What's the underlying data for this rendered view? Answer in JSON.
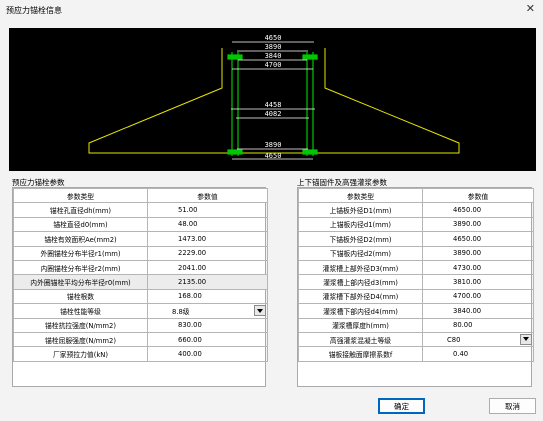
{
  "window": {
    "title": "预应力锚栓信息"
  },
  "drawing": {
    "dims_top": [
      "4650",
      "3890",
      "3840",
      "4700"
    ],
    "dims_mid": [
      "4458",
      "4082"
    ],
    "dims_bot": [
      "3890",
      "4650"
    ]
  },
  "left_panel": {
    "label": "预应力锚栓参数",
    "headers": [
      "参数类型",
      "参数值"
    ],
    "rows": [
      {
        "name": "锚栓孔直径dh(mm)",
        "value": "51.00"
      },
      {
        "name": "锚栓直径d0(mm)",
        "value": "48.00"
      },
      {
        "name": "锚栓有效面积Ae(mm2)",
        "value": "1473.00"
      },
      {
        "name": "外圈锚栓分布半径r1(mm)",
        "value": "2229.00"
      },
      {
        "name": "内圈锚栓分布半径r2(mm)",
        "value": "2041.00"
      },
      {
        "name": "内外圈锚栓平均分布半径r0(mm)",
        "value": "2135.00"
      },
      {
        "name": "锚栓根数",
        "value": "168.00"
      },
      {
        "name": "锚栓性能等级",
        "value": "8.8级"
      },
      {
        "name": "锚栓抗拉强度(N/mm2)",
        "value": "830.00"
      },
      {
        "name": "锚栓屈服强度(N/mm2)",
        "value": "660.00"
      },
      {
        "name": "厂家预拉力值(kN)",
        "value": "400.00"
      }
    ]
  },
  "right_panel": {
    "label": "上下锚固件及高强灌浆参数",
    "headers": [
      "参数类型",
      "参数值"
    ],
    "rows": [
      {
        "name": "上锚板外径D1(mm)",
        "value": "4650.00"
      },
      {
        "name": "上锚板内径d1(mm)",
        "value": "3890.00"
      },
      {
        "name": "下锚板外径D2(mm)",
        "value": "4650.00"
      },
      {
        "name": "下锚板内径d2(mm)",
        "value": "3890.00"
      },
      {
        "name": "灌浆槽上部外径D3(mm)",
        "value": "4730.00"
      },
      {
        "name": "灌浆槽上部内径d3(mm)",
        "value": "3810.00"
      },
      {
        "name": "灌浆槽下部外径D4(mm)",
        "value": "4700.00"
      },
      {
        "name": "灌浆槽下部内径d4(mm)",
        "value": "3840.00"
      },
      {
        "name": "灌浆槽厚度h(mm)",
        "value": "80.00"
      },
      {
        "name": "高强灌浆混凝土等级",
        "value": "C80"
      },
      {
        "name": "锚板接触面摩擦系数f",
        "value": "0.40"
      }
    ]
  },
  "buttons": {
    "ok": "确定",
    "cancel": "取消"
  },
  "colors": {
    "outline": "#e6e600",
    "anchor": "#00c800",
    "dim": "#ffffff"
  }
}
